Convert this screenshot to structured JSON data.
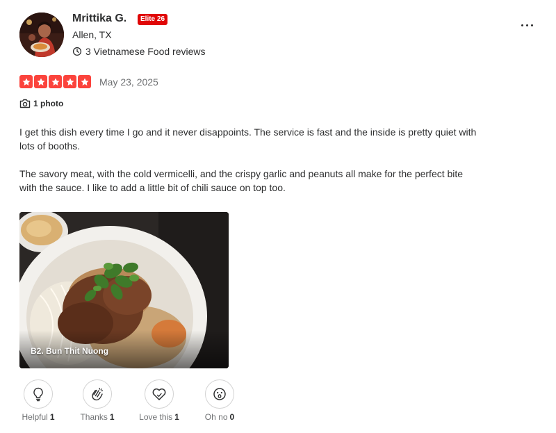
{
  "user": {
    "name": "Mrittika G.",
    "elite_badge": "Elite 26",
    "location": "Allen, TX",
    "review_count": "3 Vietnamese Food reviews"
  },
  "rating": {
    "stars": 5,
    "date": "May 23, 2025"
  },
  "photos": {
    "count_label": "1 photo",
    "caption": "B2. Bun Thit Nuong"
  },
  "review": {
    "paragraphs": [
      "I get this dish every time I go and it never disappoints. The service is fast and the inside is pretty quiet with lots of booths.",
      "The savory meat, with the cold vermicelli, and the crispy garlic and peanuts all make for the perfect bite with the sauce. I like to add a little bit of chili sauce on top too."
    ]
  },
  "reactions": [
    {
      "label": "Helpful",
      "count": "1",
      "icon": "lightbulb-icon"
    },
    {
      "label": "Thanks",
      "count": "1",
      "icon": "clapping-hands-icon"
    },
    {
      "label": "Love this",
      "count": "1",
      "icon": "heart-icon"
    },
    {
      "label": "Oh no",
      "count": "0",
      "icon": "surprised-face-icon"
    }
  ],
  "colors": {
    "star_red": "#fb433c",
    "elite_red": "#e00707",
    "text": "#2d2e2f",
    "muted": "#6e7072"
  }
}
